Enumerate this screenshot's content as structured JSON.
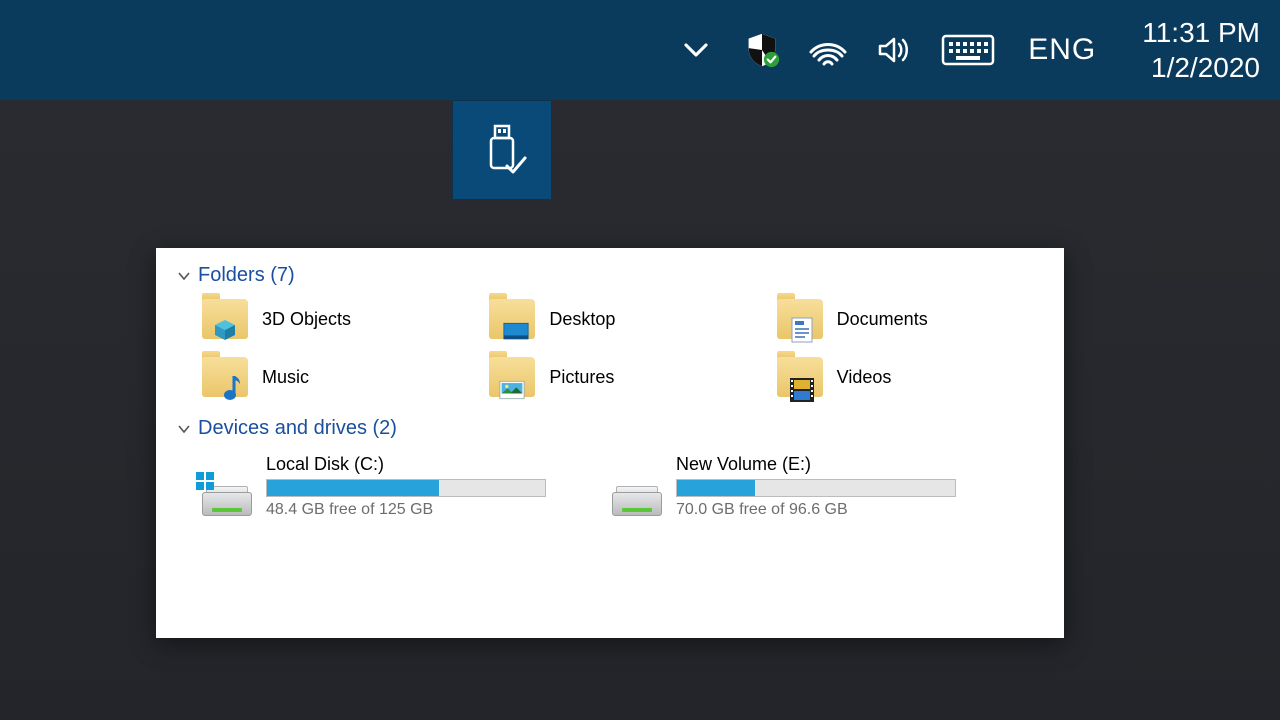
{
  "tray": {
    "lang": "ENG",
    "time": "11:31 PM",
    "date": "1/2/2020"
  },
  "explorer": {
    "sections": {
      "folders": {
        "title": "Folders (7)"
      },
      "drives": {
        "title": "Devices and drives (2)"
      }
    },
    "folders": [
      {
        "label": "3D Objects"
      },
      {
        "label": "Desktop"
      },
      {
        "label": "Documents"
      },
      {
        "label": "Music"
      },
      {
        "label": "Pictures"
      },
      {
        "label": "Videos"
      }
    ],
    "drives": [
      {
        "name": "Local Disk (C:)",
        "free": "48.4 GB free of 125 GB",
        "fill_pct": 62
      },
      {
        "name": "New Volume (E:)",
        "free": "70.0 GB free of 96.6 GB",
        "fill_pct": 28
      }
    ]
  }
}
